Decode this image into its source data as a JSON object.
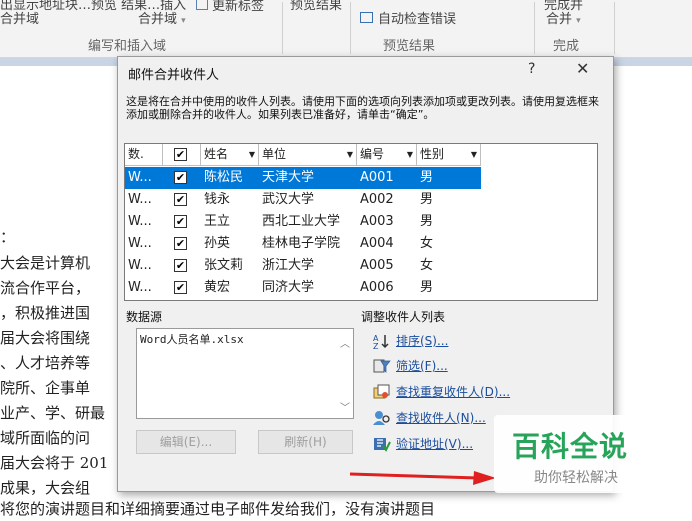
{
  "ribbon": {
    "top_left_text": "出显示地址块…预览 结果…插入",
    "merge_field_line1": "合并域",
    "merge_field_line2": "合并域",
    "update_labels": "更新标签",
    "preview_results": "预览结果",
    "auto_check_errors": "自动检查错误",
    "finish_merge": "完成并",
    "finish_merge_line2": "合并",
    "group_write_insert": "编写和插入域",
    "group_preview": "预览结果",
    "group_finish": "完成"
  },
  "document": {
    "lines": [
      "：",
      "大会是计算机",
      "流合作平台，",
      "，积极推进国",
      "届大会将围绕",
      "、人才培养等",
      "院所、企事单",
      "业产、学、研最",
      "域所面临的问",
      "届大会将于 201",
      "成果，大会组",
      "将您的演讲题目和详细摘要通过电子邮件发给我们，没有演讲题目"
    ]
  },
  "dialog": {
    "title": "邮件合并收件人",
    "help": "?",
    "close": "✕",
    "description": "这是将在合并中使用的收件人列表。请使用下面的选项向列表添加项或更改列表。请使用复选框来添加或删除合并的收件人。如果列表已准备好，请单击“确定”。",
    "columns": [
      "数.",
      "",
      "姓名",
      "单位",
      "编号",
      "性别"
    ],
    "rows": [
      {
        "src": "W...",
        "checked": true,
        "name": "陈松民",
        "unit": "天津大学",
        "code": "A001",
        "gender": "男"
      },
      {
        "src": "W...",
        "checked": true,
        "name": "钱永",
        "unit": "武汉大学",
        "code": "A002",
        "gender": "男"
      },
      {
        "src": "W...",
        "checked": true,
        "name": "王立",
        "unit": "西北工业大学",
        "code": "A003",
        "gender": "男"
      },
      {
        "src": "W...",
        "checked": true,
        "name": "孙英",
        "unit": "桂林电子学院",
        "code": "A004",
        "gender": "女"
      },
      {
        "src": "W...",
        "checked": true,
        "name": "张文莉",
        "unit": "浙江大学",
        "code": "A005",
        "gender": "女"
      },
      {
        "src": "W...",
        "checked": true,
        "name": "黄宏",
        "unit": "同济大学",
        "code": "A006",
        "gender": "男"
      }
    ],
    "datasource_label": "数据源",
    "datasource_item": "Word人员名单.xlsx",
    "edit_button": "编辑(E)...",
    "refresh_button": "刷新(H)",
    "adjust_label": "调整收件人列表",
    "actions": {
      "sort": "排序(S)...",
      "filter": "筛选(F)...",
      "find_duplicates": "查找重复收件人(D)...",
      "find_recipient": "查找收件人(N)...",
      "validate_address": "验证地址(V)..."
    }
  },
  "watermark": {
    "main": "百科全说",
    "sub": "助你轻松解决"
  },
  "colors": {
    "selection": "#0078d7",
    "link": "#1a4d9c",
    "arrow": "#e02020",
    "watermark_green": "#27a45a"
  }
}
